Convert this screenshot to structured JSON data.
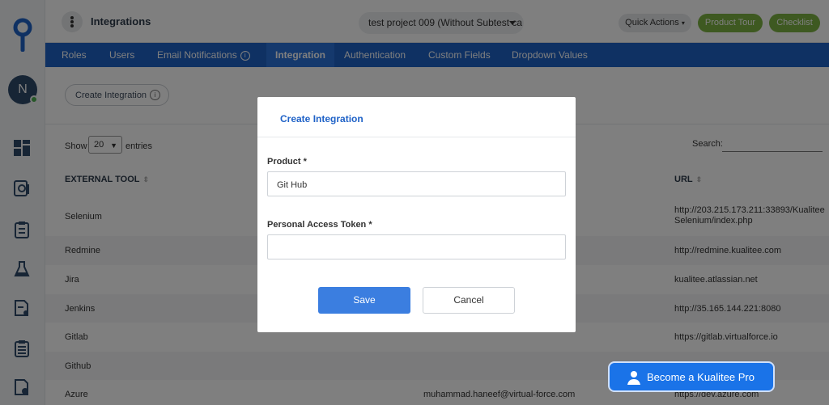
{
  "topbar": {
    "title": "Integrations",
    "project": "test project 009 (Without Subtest ca",
    "quick_actions": "Quick Actions",
    "product_tour": "Product Tour",
    "checklist": "Checklist"
  },
  "sidebar": {
    "avatar_initial": "N",
    "icons": [
      "dashboard-icon",
      "settings-gear-icon",
      "clipboard-icon",
      "flask-icon",
      "report-icon",
      "clipboard-list-icon",
      "document-check-icon"
    ]
  },
  "tabs": [
    {
      "label": "Roles"
    },
    {
      "label": "Users"
    },
    {
      "label": "Email Notifications"
    },
    {
      "label": "Integration"
    },
    {
      "label": "Authentication"
    },
    {
      "label": "Custom Fields"
    },
    {
      "label": "Dropdown Values"
    }
  ],
  "content": {
    "create_label": "Create Integration",
    "show_label": "Show",
    "page_size": "20",
    "entries_label": "entries",
    "search_label": "Search:",
    "columns": [
      "EXTERNAL TOOL",
      "URL"
    ],
    "rows": [
      {
        "tool": "Selenium",
        "user": "",
        "url": "http://203.215.173.211:33893/Kualitee Selenium/index.php"
      },
      {
        "tool": "Redmine",
        "user": "",
        "url": "http://redmine.kualitee.com"
      },
      {
        "tool": "Jira",
        "user": "",
        "url": "kualitee.atlassian.net"
      },
      {
        "tool": "Jenkins",
        "user": "",
        "url": "http://35.165.144.221:8080"
      },
      {
        "tool": "Gitlab",
        "user": "",
        "url": "https://gitlab.virtualforce.io"
      },
      {
        "tool": "Github",
        "user": "",
        "url": ""
      },
      {
        "tool": "Azure",
        "user": "muhammad.haneef@virtual-force.com",
        "url": "https://dev.azure.com"
      }
    ]
  },
  "modal": {
    "title": "Create Integration",
    "product_label": "Product *",
    "product_value": "Git Hub",
    "token_label": "Personal Access Token *",
    "token_value": "",
    "save_label": "Save",
    "cancel_label": "Cancel"
  },
  "promo": {
    "label": "Become a Kualitee Pro"
  },
  "colors": {
    "tab_bar": "#1f62c7",
    "accent_green": "#7cb342",
    "primary_button": "#3b7ee0",
    "modal_title": "#1f62c7"
  }
}
